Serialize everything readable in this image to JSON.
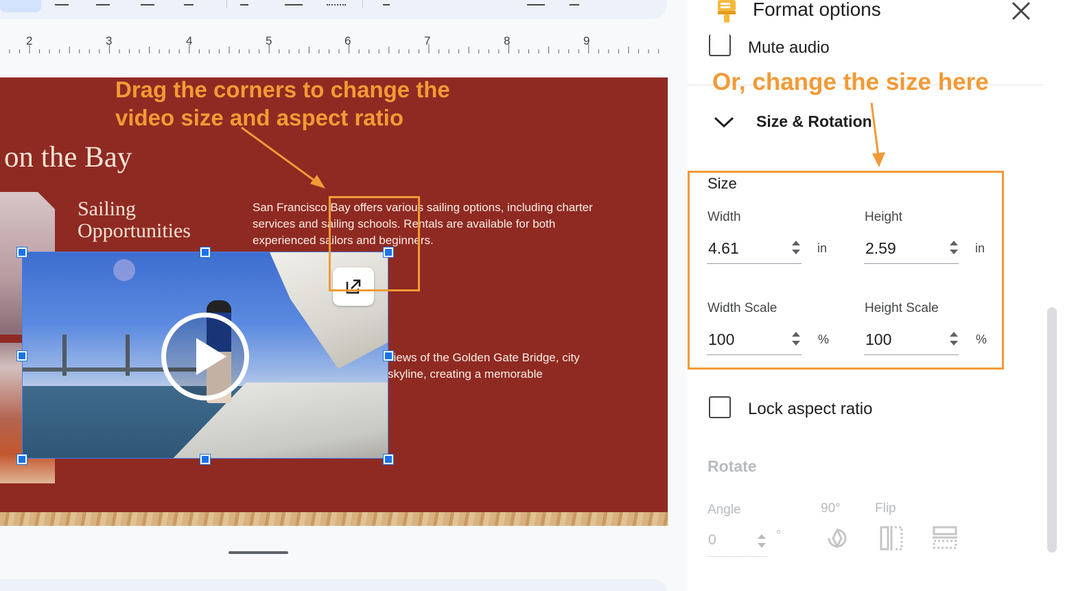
{
  "ruler": {
    "numbers": [
      "2",
      "3",
      "4",
      "5",
      "6",
      "7",
      "8",
      "9"
    ]
  },
  "slide": {
    "title": "on the Bay",
    "subtitle": "Sailing Opportunities",
    "body": "San Francisco Bay offers various sailing options, including charter services and sailing schools. Rentals are available for both experienced sailors and beginners.",
    "body2": "views of the Golden Gate Bridge, city skyline, creating a memorable"
  },
  "annotations": {
    "left": "Drag the corners to change the video size and aspect ratio",
    "right": "Or, change the size here"
  },
  "panel": {
    "title": "Format options",
    "mute_audio": "Mute audio",
    "size_rotation": "Size & Rotation",
    "size": {
      "label": "Size",
      "width_label": "Width",
      "width_value": "4.61",
      "width_unit": "in",
      "height_label": "Height",
      "height_value": "2.59",
      "height_unit": "in",
      "width_scale_label": "Width Scale",
      "width_scale_value": "100",
      "width_scale_unit": "%",
      "height_scale_label": "Height Scale",
      "height_scale_value": "100",
      "height_scale_unit": "%"
    },
    "lock_aspect_ratio": "Lock aspect ratio",
    "rotate": {
      "label": "Rotate",
      "angle_label": "Angle",
      "angle_value": "0",
      "angle_unit": "°",
      "ninety_label": "90°",
      "flip_label": "Flip"
    }
  },
  "colors": {
    "accent_orange": "#f29a36",
    "slide_red": "#8f2a22",
    "selection_blue": "#1a73e8"
  },
  "icons": [
    "paint-brush-icon",
    "close-icon",
    "chevron-down-icon",
    "open-external-icon",
    "play-icon",
    "rotate-90-icon",
    "flip-horizontal-icon",
    "flip-vertical-icon"
  ]
}
